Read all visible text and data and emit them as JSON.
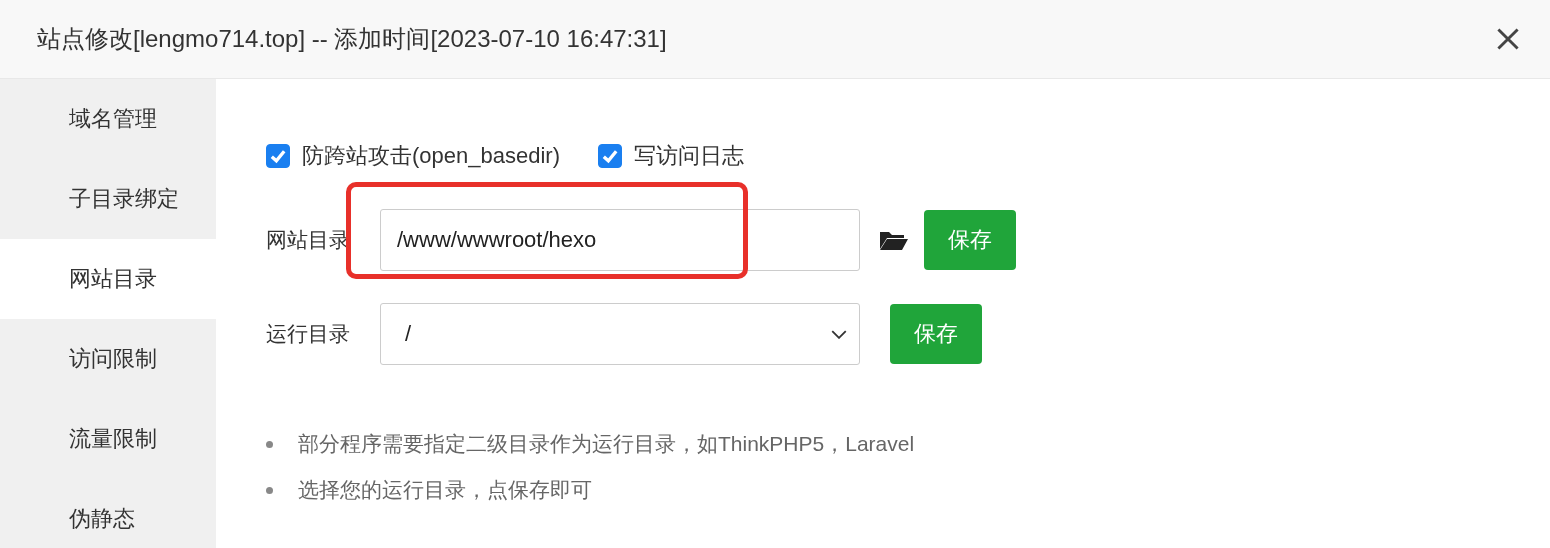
{
  "window": {
    "title": "站点修改[lengmo714.top] -- 添加时间[2023-07-10 16:47:31]"
  },
  "sidebar": {
    "items": [
      {
        "label": "域名管理",
        "selected": false
      },
      {
        "label": "子目录绑定",
        "selected": false
      },
      {
        "label": "网站目录",
        "selected": true
      },
      {
        "label": "访问限制",
        "selected": false
      },
      {
        "label": "流量限制",
        "selected": false
      },
      {
        "label": "伪静态",
        "selected": false
      }
    ]
  },
  "options": [
    {
      "label": "防跨站攻击(open_basedir)",
      "checked": true
    },
    {
      "label": "写访问日志",
      "checked": true
    }
  ],
  "site_dir": {
    "label": "网站目录",
    "value": "/www/wwwroot/hexo",
    "button": "保存",
    "highlighted": true
  },
  "run_dir": {
    "label": "运行目录",
    "value": "/",
    "button": "保存"
  },
  "tips": [
    "部分程序需要指定二级目录作为运行目录，如ThinkPHP5，Laravel",
    "选择您的运行目录，点保存即可"
  ]
}
